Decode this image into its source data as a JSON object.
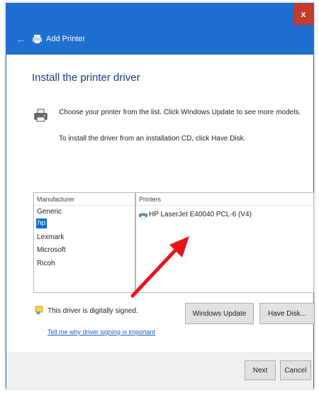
{
  "window": {
    "close_label": "x"
  },
  "nav": {
    "title": "Add Printer"
  },
  "page": {
    "heading": "Install the printer driver",
    "description_line1": "Choose your printer from the list. Click Windows Update to see more models.",
    "description_line2": "To install the driver from an installation CD, click Have Disk."
  },
  "manufacturers": {
    "header": "Manufacturer",
    "items": [
      "Generic",
      "hp",
      "Lexmark",
      "Microsoft",
      "Ricoh"
    ],
    "selected": "hp"
  },
  "printers": {
    "header": "Printers",
    "items": [
      "HP LaserJet E40040 PCL-6 (V4)"
    ]
  },
  "signing": {
    "status": "This driver is digitally signed.",
    "link": "Tell me why driver signing is important"
  },
  "buttons": {
    "windows_update": "Windows Update",
    "have_disk": "Have Disk...",
    "next": "Next",
    "cancel": "Cancel"
  },
  "colors": {
    "title_bar": "#1f6fd1",
    "close": "#c43b2e",
    "heading": "#1a3a8a",
    "selection": "#0a6ed8",
    "annotation_arrow": "#e5161b"
  }
}
